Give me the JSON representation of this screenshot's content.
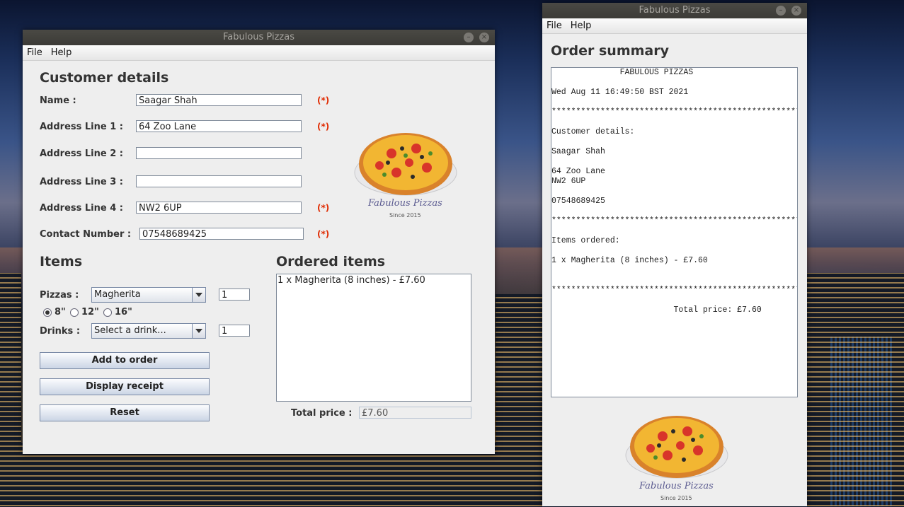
{
  "order_window": {
    "title": "Fabulous Pizzas",
    "menu": [
      "File",
      "Help"
    ],
    "customer_heading": "Customer details",
    "fields": [
      {
        "label": "Name :",
        "value": "Saagar Shah",
        "required": "(*)"
      },
      {
        "label": "Address Line 1 :",
        "value": "64 Zoo Lane",
        "required": "(*)"
      },
      {
        "label": "Address Line 2 :",
        "value": "",
        "required": ""
      },
      {
        "label": "Address Line 3 :",
        "value": "",
        "required": ""
      },
      {
        "label": "Address Line 4 :",
        "value": "NW2 6UP",
        "required": "(*)"
      },
      {
        "label": "Contact Number :",
        "value": "07548689425",
        "required": "(*)"
      }
    ],
    "logo": {
      "brand": "Fabulous Pizzas",
      "since": "Since 2015"
    },
    "items_heading": "Items",
    "pizzas_label": "Pizzas :",
    "pizza_selected": "Magherita",
    "pizza_qty": "1",
    "sizes": [
      {
        "label": "8\"",
        "selected": true
      },
      {
        "label": "12\"",
        "selected": false
      },
      {
        "label": "16\"",
        "selected": false
      }
    ],
    "drinks_label": "Drinks :",
    "drink_selected": "Select a drink...",
    "drink_qty": "1",
    "buttons": {
      "add": "Add to order",
      "receipt": "Display receipt",
      "reset": "Reset"
    },
    "ordered_heading": "Ordered items",
    "ordered_items": [
      "1 x Magherita (8 inches) - £7.60"
    ],
    "total_label": "Total price :",
    "total_value": "£7.60"
  },
  "summary_window": {
    "title": "Fabulous Pizzas",
    "menu": [
      "File",
      "Help"
    ],
    "heading": "Order summary",
    "receipt_lines": [
      "              FABULOUS PIZZAS",
      "",
      "Wed Aug 11 16:49:50 BST 2021",
      "",
      "*******************************************************",
      "",
      "Customer details:",
      "",
      "Saagar Shah",
      "",
      "64 Zoo Lane",
      "NW2 6UP",
      "",
      "07548689425",
      "",
      "*******************************************************",
      "",
      "Items ordered:",
      "",
      "1 x Magherita (8 inches) - £7.60",
      "",
      "",
      "*******************************************************",
      "",
      "                         Total price: £7.60"
    ],
    "logo": {
      "brand": "Fabulous Pizzas",
      "since": "Since 2015"
    }
  }
}
